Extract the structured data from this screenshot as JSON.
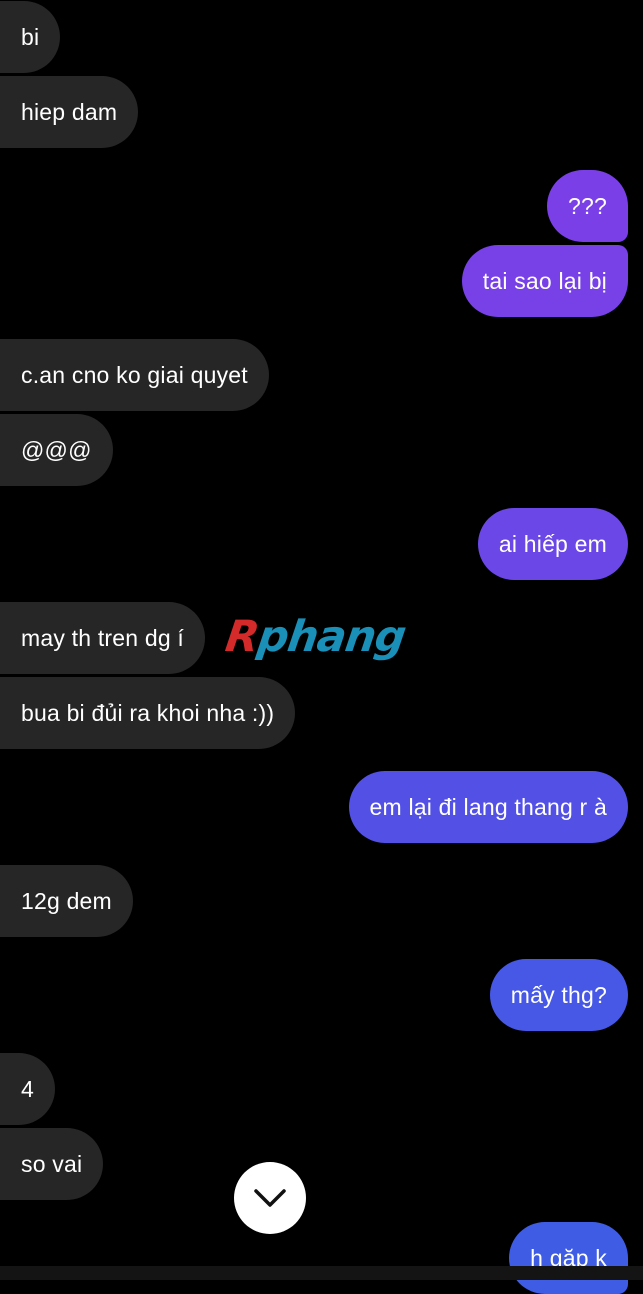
{
  "colors": {
    "background": "#000000",
    "incoming_bubble": "#262626",
    "outgoing_gradient_top": "#7b3fe6",
    "outgoing_gradient_bottom": "#3d5de4",
    "text": "#ffffff",
    "watermark_red": "#d42a2a",
    "watermark_blue": "#1a8fb8"
  },
  "messages": [
    {
      "sender": "them",
      "text": "bi"
    },
    {
      "sender": "them",
      "text": "hiep dam"
    },
    {
      "sender": "me",
      "text": "???"
    },
    {
      "sender": "me",
      "text": "tai sao lại bị"
    },
    {
      "sender": "them",
      "text": "c.an cno ko giai quyet"
    },
    {
      "sender": "them",
      "text": "@@@"
    },
    {
      "sender": "me",
      "text": "ai hiếp em"
    },
    {
      "sender": "them",
      "text": "may th tren dg í"
    },
    {
      "sender": "them",
      "text": "bua bi đủi ra khoi nha :))"
    },
    {
      "sender": "me",
      "text": "em lại đi lang thang r à"
    },
    {
      "sender": "them",
      "text": "12g dem"
    },
    {
      "sender": "me",
      "text": "mấy thg?"
    },
    {
      "sender": "them",
      "text": "4"
    },
    {
      "sender": "them",
      "text": "so vai"
    },
    {
      "sender": "me",
      "text": "h gặp k"
    }
  ],
  "watermark": {
    "first_letter": "R",
    "rest": "phang"
  },
  "scroll_button": {
    "icon": "chevron-down-icon"
  }
}
